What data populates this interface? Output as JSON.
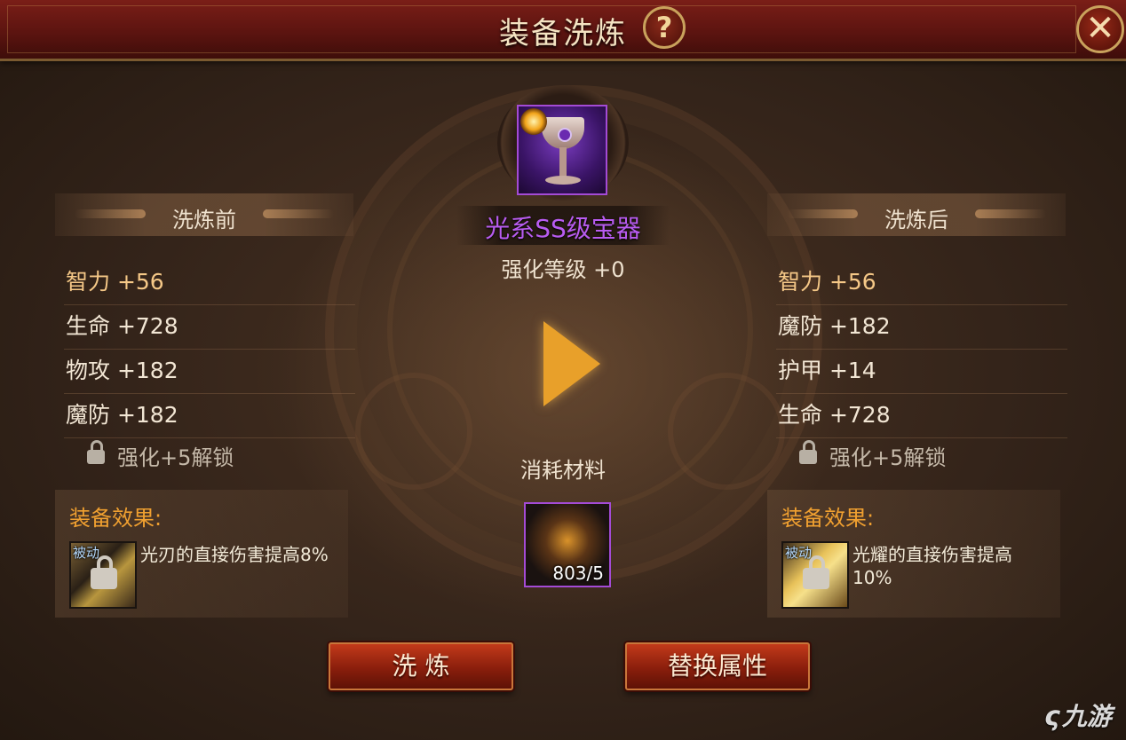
{
  "window": {
    "title": "装备洗炼",
    "help_glyph": "?",
    "close_glyph": "✕"
  },
  "item": {
    "name": "光系SS级宝器",
    "enhance_level": "强化等级 +0",
    "icon": "chalice-icon",
    "element_icon": "sun-icon"
  },
  "before": {
    "header": "洗炼前",
    "stats": [
      "智力 +56",
      "生命 +728",
      "物攻 +182",
      "魔防 +182"
    ],
    "locked_slot": "强化+5解锁",
    "effect_title": "装备效果:",
    "skill_tag": "被动",
    "effect_desc": "光刃的直接伤害提高8%"
  },
  "after": {
    "header": "洗炼后",
    "stats": [
      "智力 +56",
      "魔防 +182",
      "护甲 +14",
      "生命 +728"
    ],
    "locked_slot": "强化+5解锁",
    "effect_title": "装备效果:",
    "skill_tag": "被动",
    "effect_desc": "光耀的直接伤害提高10%"
  },
  "material": {
    "label": "消耗材料",
    "count": "803/5",
    "icon": "ore-icon"
  },
  "buttons": {
    "refine": "洗 炼",
    "replace": "替换属性"
  },
  "watermark": {
    "text": "九游",
    "logo_glyph": "ς"
  },
  "colors": {
    "item_name": "#b85cf0",
    "effect_title": "#f0a030",
    "title_bar": "#6a1812",
    "first_stat": "#f5c887"
  }
}
